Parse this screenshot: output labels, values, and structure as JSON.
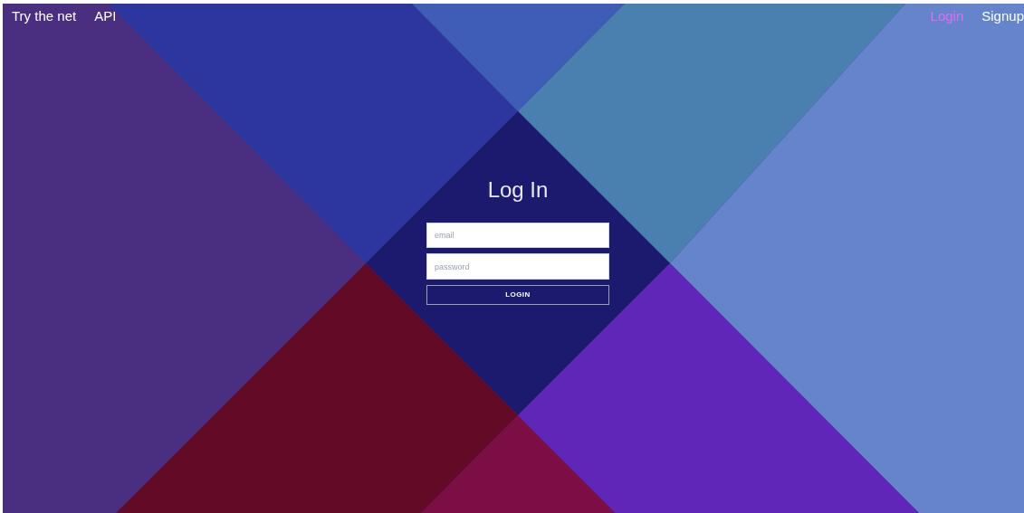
{
  "nav_left": [
    {
      "label": "Try the net",
      "selected": false
    },
    {
      "label": "API",
      "selected": false
    }
  ],
  "nav_right": [
    {
      "label": "Login",
      "selected": true
    },
    {
      "label": "Signup",
      "selected": false
    }
  ],
  "form": {
    "title": "Log In",
    "email": {
      "placeholder": "email"
    },
    "password": {
      "placeholder": "password"
    },
    "submit": "LOGIN"
  }
}
